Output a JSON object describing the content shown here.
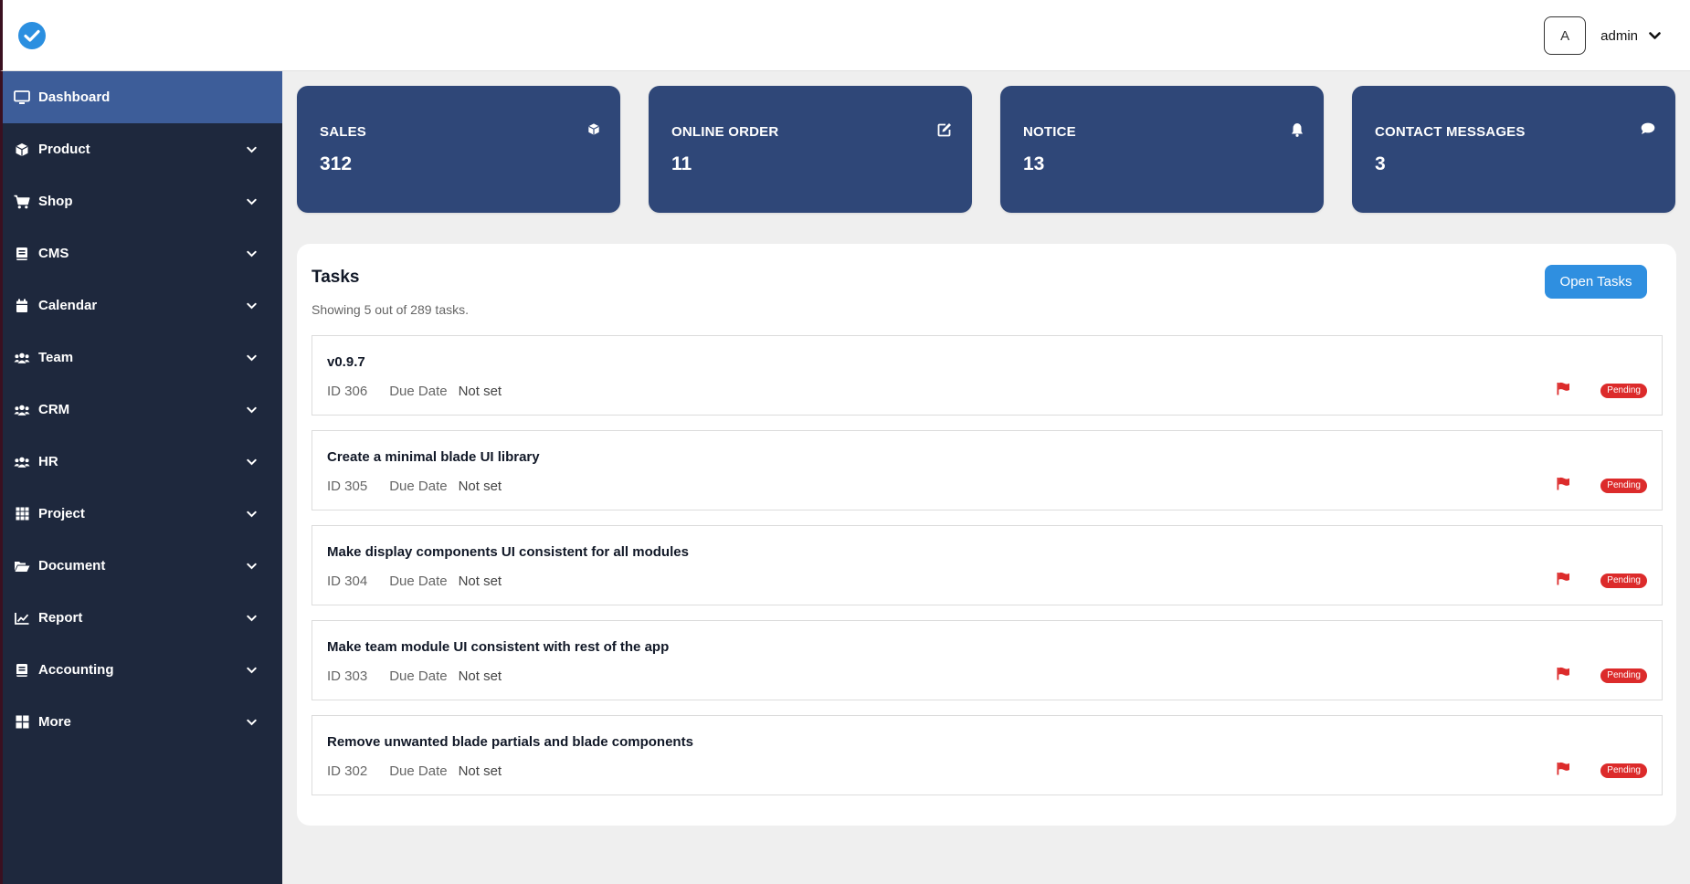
{
  "header": {
    "user_initial": "A",
    "username": "admin"
  },
  "sidebar": {
    "items": [
      {
        "label": "Dashboard",
        "icon": "monitor-icon"
      },
      {
        "label": "Product",
        "icon": "cube-icon"
      },
      {
        "label": "Shop",
        "icon": "cart-icon"
      },
      {
        "label": "CMS",
        "icon": "book-icon"
      },
      {
        "label": "Calendar",
        "icon": "calendar-icon"
      },
      {
        "label": "Team",
        "icon": "users-icon"
      },
      {
        "label": "CRM",
        "icon": "users-icon"
      },
      {
        "label": "HR",
        "icon": "users-icon"
      },
      {
        "label": "Project",
        "icon": "grid-icon"
      },
      {
        "label": "Document",
        "icon": "folder-open-icon"
      },
      {
        "label": "Report",
        "icon": "chart-line-icon"
      },
      {
        "label": "Accounting",
        "icon": "book-icon"
      },
      {
        "label": "More",
        "icon": "tiles-icon"
      }
    ]
  },
  "cards": [
    {
      "label": "SALES",
      "value": "312",
      "icon": "cube-icon"
    },
    {
      "label": "ONLINE ORDER",
      "value": "11",
      "icon": "edit-icon"
    },
    {
      "label": "NOTICE",
      "value": "13",
      "icon": "bell-icon"
    },
    {
      "label": "CONTACT MESSAGES",
      "value": "3",
      "icon": "comment-icon"
    }
  ],
  "tasks": {
    "title": "Tasks",
    "subtitle": "Showing 5 out of 289 tasks.",
    "open_button": "Open Tasks",
    "due_label": "Due Date",
    "items": [
      {
        "title": "v0.9.7",
        "id": "ID 306",
        "due": "Not set",
        "status": "Pending"
      },
      {
        "title": "Create a minimal blade UI library",
        "id": "ID 305",
        "due": "Not set",
        "status": "Pending"
      },
      {
        "title": "Make display components UI consistent for all modules",
        "id": "ID 304",
        "due": "Not set",
        "status": "Pending"
      },
      {
        "title": "Make team module UI consistent with rest of the app",
        "id": "ID 303",
        "due": "Not set",
        "status": "Pending"
      },
      {
        "title": "Remove unwanted blade partials and blade components",
        "id": "ID 302",
        "due": "Not set",
        "status": "Pending"
      }
    ]
  },
  "colors": {
    "sidebar": "#1e283d",
    "active": "#3d5d99",
    "card": "#2f4778",
    "accent": "#2f8fe0",
    "pending": "#dc2b2b"
  }
}
